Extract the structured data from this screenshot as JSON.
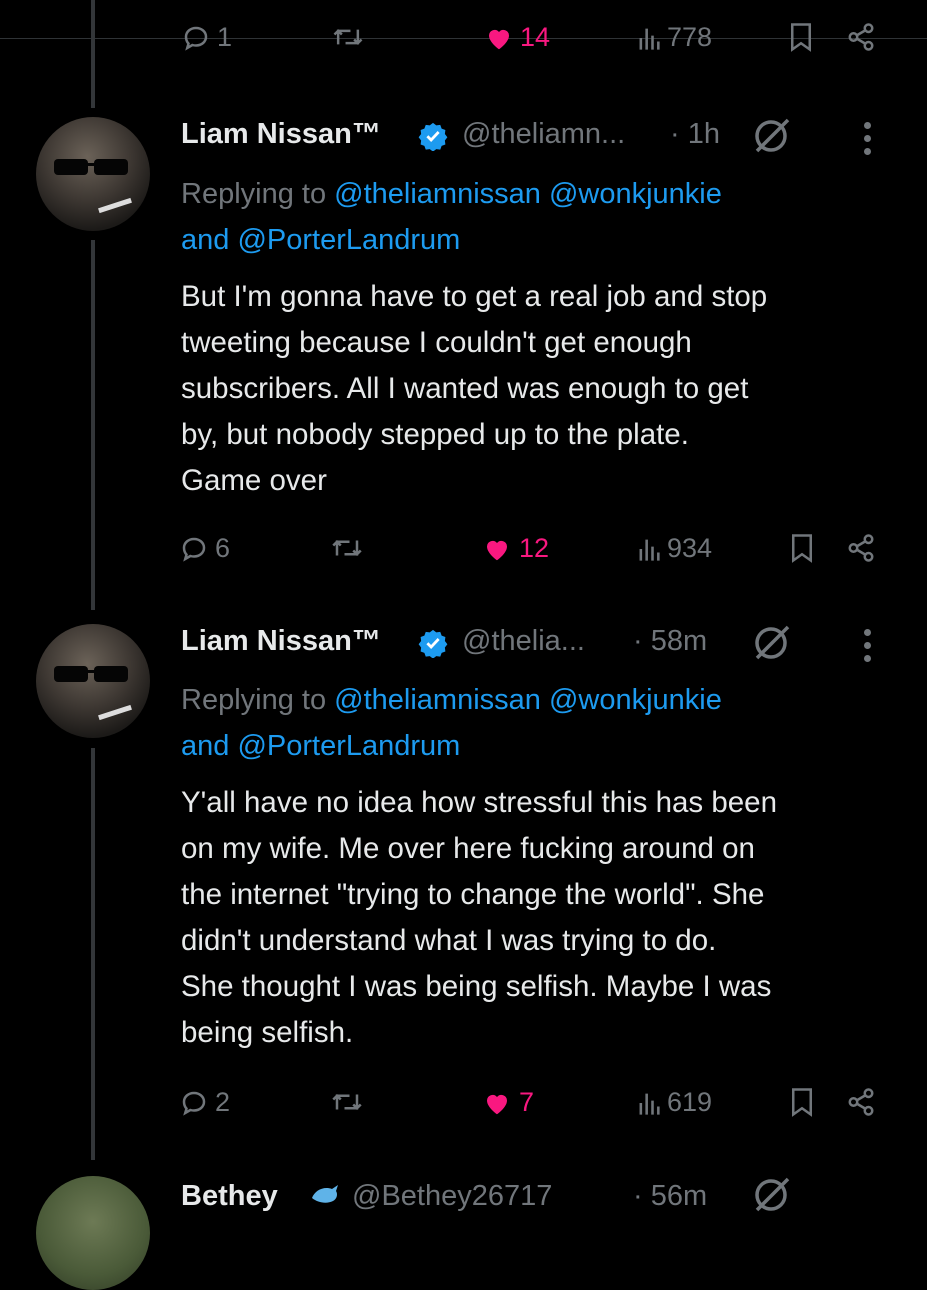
{
  "top_partial": {
    "reply_count": "1",
    "like_count": "14",
    "view_count": "778"
  },
  "tweets": [
    {
      "author_name": "Liam Nissan™",
      "handle": "@theliamn...",
      "time": "· 1h",
      "replying_prefix": "Replying to",
      "mentions_line1": "@theliamnissan @wonkjunkie",
      "mentions_and": "and",
      "mentions_line2": "@PorterLandrum",
      "body_lines": [
        "But I'm gonna have to get a real job and stop",
        "tweeting because I couldn't get enough",
        "subscribers. All I wanted was enough to get",
        "by, but nobody stepped up to the plate.",
        "Game over"
      ],
      "reply_count": "6",
      "like_count": "12",
      "view_count": "934"
    },
    {
      "author_name": "Liam Nissan™",
      "handle": "@thelia...",
      "time": "· 58m",
      "replying_prefix": "Replying to",
      "mentions_line1": "@theliamnissan @wonkjunkie",
      "mentions_and": "and",
      "mentions_line2": "@PorterLandrum",
      "body_lines": [
        "Y'all have no idea how stressful this has been",
        "on my wife. Me over here fucking around on",
        "the internet \"trying to change the world\". She",
        "didn't understand what I was trying to do.",
        "She thought I was being selfish. Maybe I was",
        "being selfish."
      ],
      "reply_count": "2",
      "like_count": "7",
      "view_count": "619"
    }
  ],
  "bottom_partial": {
    "author_name": "Bethey",
    "handle": "@Bethey26717",
    "time": "· 56m"
  },
  "colors": {
    "background": "#000000",
    "text": "#e7e9ea",
    "secondary": "#71767b",
    "link": "#1d9bf0",
    "like": "#f91880",
    "verified": "#1d9bf0"
  },
  "icons": [
    "reply-icon",
    "retweet-icon",
    "heart-icon",
    "views-icon",
    "bookmark-icon",
    "share-icon",
    "verified-icon",
    "grok-icon",
    "more-icon"
  ]
}
